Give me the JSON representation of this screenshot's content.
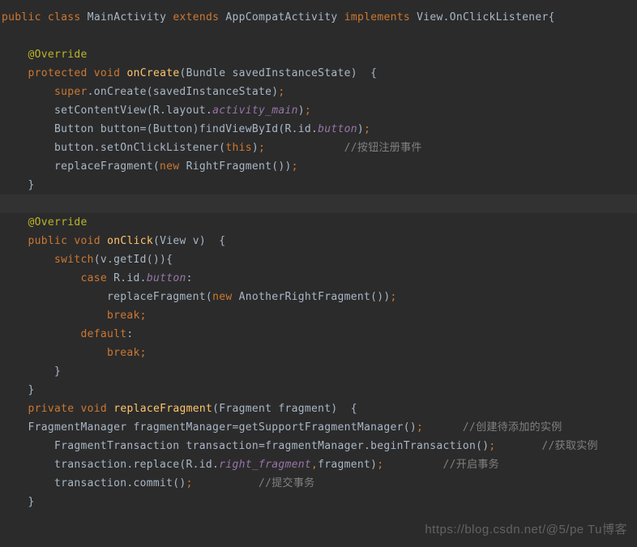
{
  "code": {
    "l1": {
      "public": "public",
      "class": "class",
      "main": "MainActivity",
      "extends": "extends",
      "appcompat": "AppCompatActivity",
      "implements": "implements",
      "view": "View.OnClickListener{"
    },
    "l3_override": "@Override",
    "l4": {
      "protected": "protected",
      "void": "void",
      "oncreate": "onCreate",
      "params": "(Bundle savedInstanceState)  {"
    },
    "l5": {
      "super": "super",
      "rest": ".onCreate(savedInstanceState)",
      "semi": ";"
    },
    "l6": {
      "call": "setContentView(R.layout.",
      "field": "activity_main",
      "close": ")",
      "semi": ";"
    },
    "l7": {
      "text": "Button button=(Button)findViewById(R.id.",
      "field": "button",
      "close": ")",
      "semi": ";"
    },
    "l8": {
      "text": "button.setOnClickListener(",
      "this": "this",
      "close": ")",
      "semi": ";",
      "comment": "//按钮注册事件"
    },
    "l9": {
      "text": "replaceFragment(",
      "new": "new",
      "rest": " RightFragment())",
      "semi": ";"
    },
    "l10": "}",
    "l12_override": "@Override",
    "l13": {
      "public": "public",
      "void": "void",
      "onclick": "onClick",
      "params": "(View v)  {"
    },
    "l14": {
      "switch": "switch",
      "params": "(v.getId()){"
    },
    "l15": {
      "case": "case",
      "rid": " R.id.",
      "field": "button",
      "colon": ":"
    },
    "l16": {
      "call": "replaceFragment(",
      "new": "new",
      "rest": " AnotherRightFragment())",
      "semi": ";"
    },
    "l17": {
      "break": "break",
      "semi": ";"
    },
    "l18": {
      "default": "default",
      "colon": ":"
    },
    "l19": {
      "break": "break",
      "semi": ";"
    },
    "l20": "}",
    "l21": "}",
    "l22": {
      "private": "private",
      "void": "void",
      "method": "replaceFragment",
      "params": "(Fragment fragment)  {"
    },
    "l23": {
      "text": "FragmentManager fragmentManager=getSupportFragmentManager()",
      "semi": ";",
      "comment": "//创建待添加的实例"
    },
    "l24": {
      "text": "FragmentTransaction transaction=fragmentManager.beginTransaction()",
      "semi": ";",
      "comment": "//获取实例"
    },
    "l25": {
      "text": "transaction.replace(R.id.",
      "field": "right_fragment",
      "comma": ",",
      "rest": "fragment)",
      "semi": ";",
      "comment": "//开启事务"
    },
    "l26": {
      "text": "transaction.commit()",
      "semi": ";",
      "comment": "//提交事务"
    },
    "l27": "}"
  },
  "watermark": "https://blog.csdn.net/@5/pe Tu博客"
}
